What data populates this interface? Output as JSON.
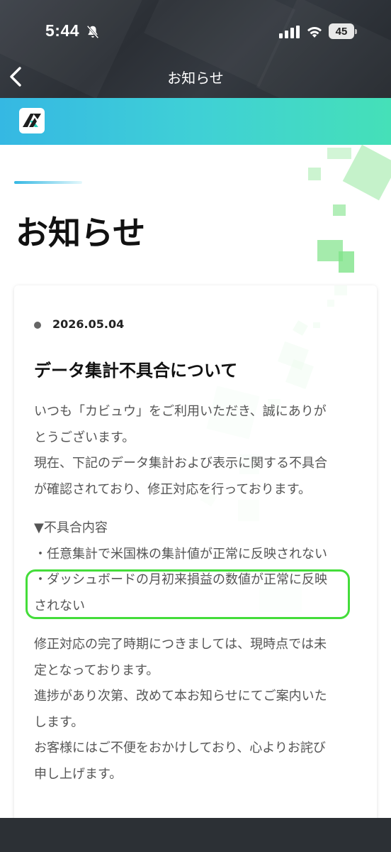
{
  "status_bar": {
    "time": "5:44",
    "battery": "45",
    "icons": [
      "bell-slash-icon",
      "signal-icon",
      "wifi-icon",
      "battery-icon"
    ]
  },
  "nav": {
    "back_icon": "chevron-left-icon",
    "title": "お知らせ"
  },
  "brand": {
    "logo_icon": "app-logo-icon",
    "gradient": [
      "#35b8e3",
      "#45e0b8"
    ]
  },
  "page": {
    "heading": "お知らせ"
  },
  "notice": {
    "date": "2026.05.04",
    "title": "データ集計不具合について",
    "paragraph1": [
      "いつも「カビュウ」をご利用いただき、誠にありが",
      "とうございます。"
    ],
    "paragraph2": [
      "現在、下記のデータ集計および表示に関する不具合",
      "が確認されており、修正対応を行っております。"
    ],
    "issues_heading": "▼不具合内容",
    "issues": [
      [
        "・任意集計で米国株の集計値が正常に反映されない"
      ],
      [
        "・ダッシュボードの月初来損益の数値が正常に反映",
        "されない"
      ]
    ],
    "paragraph3": [
      "修正対応の完了時期につきましては、現時点では未",
      "定となっております。"
    ],
    "paragraph4": [
      "進捗があり次第、改めて本お知らせにてご案内いた",
      "します。"
    ],
    "paragraph5": [
      "お客様にはご不便をおかけしており、心よりお詫び",
      "申し上げます。"
    ]
  },
  "colors": {
    "highlight": "#44dd3a",
    "accent_green": "#7fe389",
    "topbar": "#2b2f35"
  }
}
